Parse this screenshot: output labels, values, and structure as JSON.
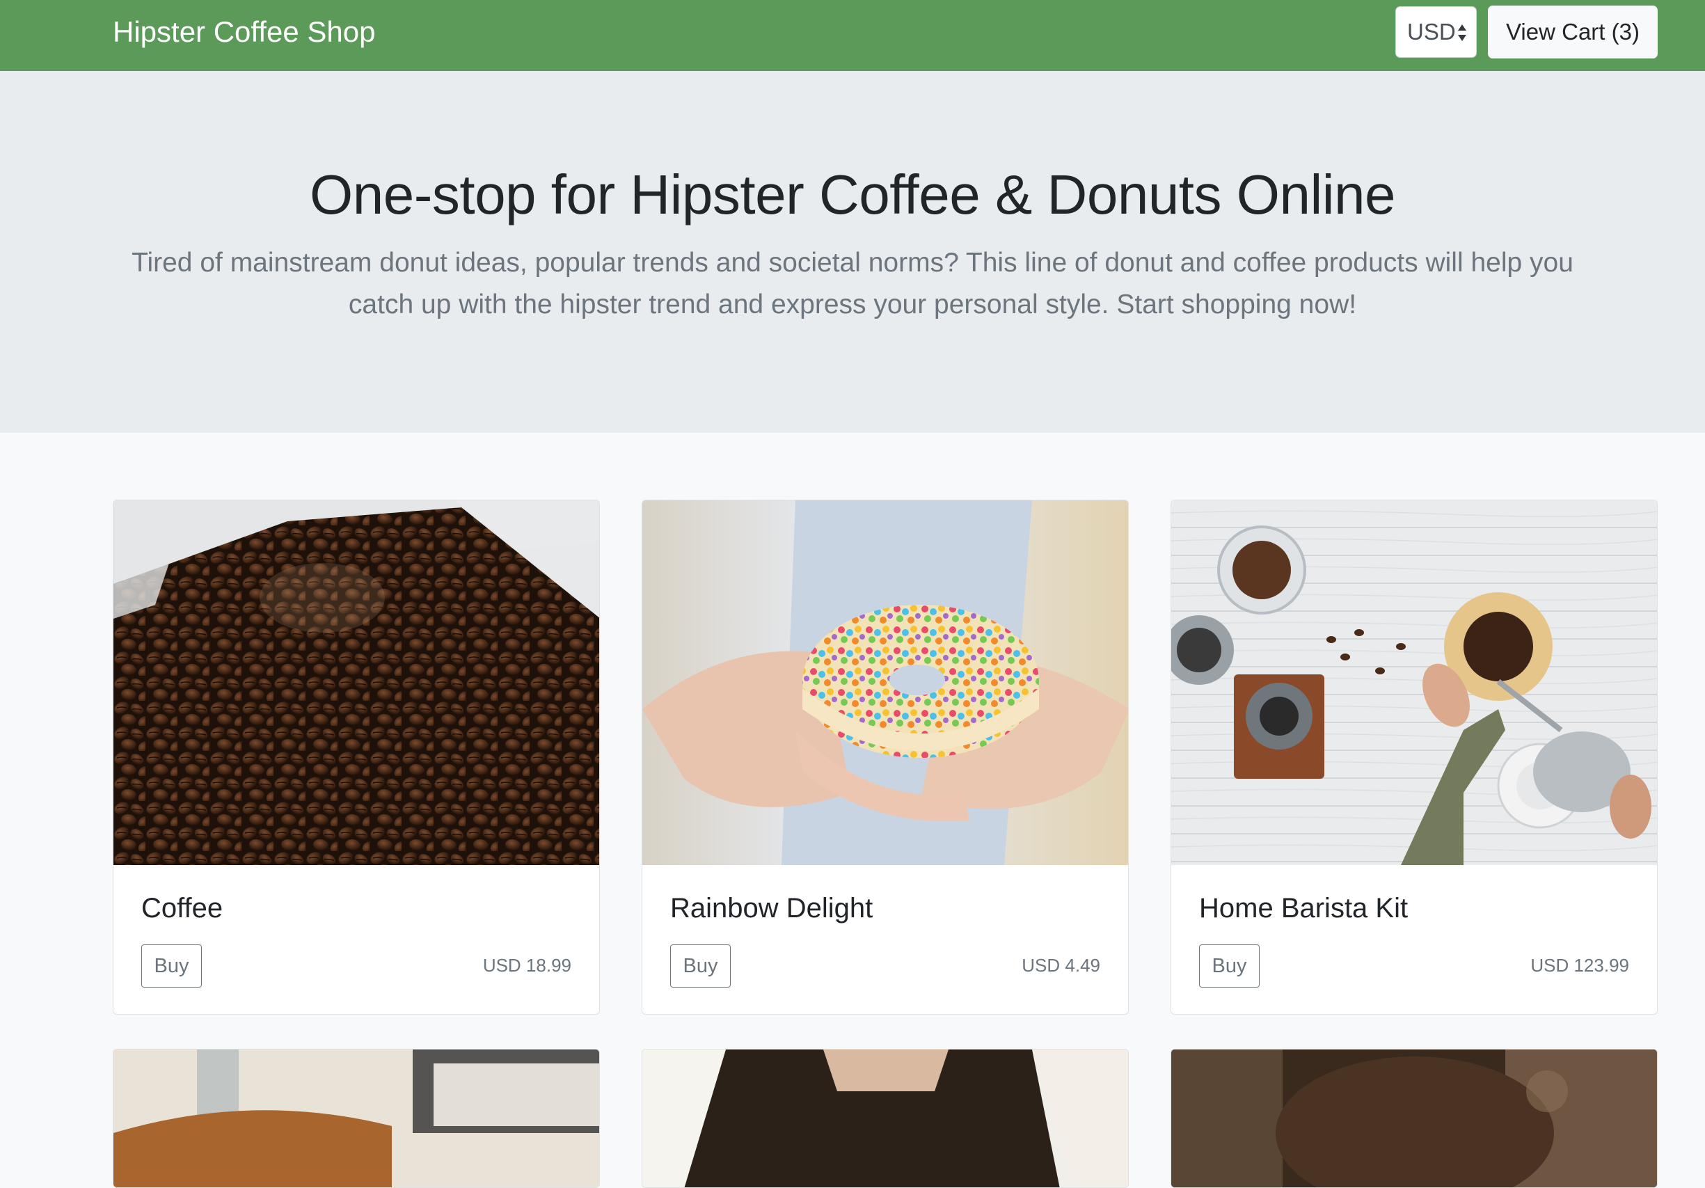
{
  "navbar": {
    "brand": "Hipster Coffee Shop",
    "currency": "USD",
    "cart_label": "View Cart (3)"
  },
  "hero": {
    "title": "One-stop for Hipster Coffee & Donuts Online",
    "lead": "Tired of mainstream donut ideas, popular trends and societal norms? This line of donut and coffee products will help you catch up with the hipster trend and express your personal style. Start shopping now!"
  },
  "products": [
    {
      "name": "Coffee",
      "buy_label": "Buy",
      "price": "USD 18.99",
      "image": "coffee-beans-photo"
    },
    {
      "name": "Rainbow Delight",
      "buy_label": "Buy",
      "price": "USD 4.49",
      "image": "rainbow-donut-photo"
    },
    {
      "name": "Home Barista Kit",
      "buy_label": "Buy",
      "price": "USD 123.99",
      "image": "barista-kit-photo"
    }
  ],
  "colors": {
    "navbar": "#5b9a58",
    "hero_bg": "#e9ecef",
    "page_bg": "#f8f9fa",
    "muted": "#6c757d"
  }
}
